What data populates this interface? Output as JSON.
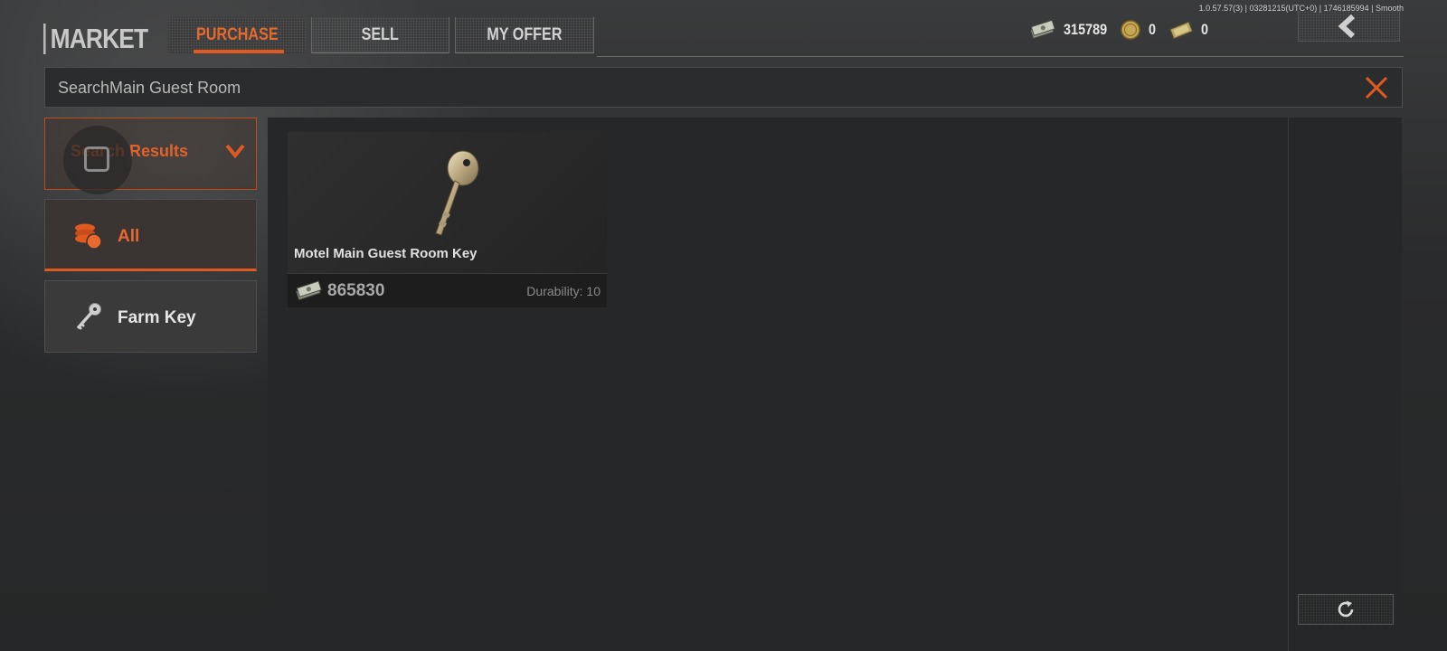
{
  "version_info": "1.0.57.57(3) | 03281215(UTC+0) | 1746185994 | Smooth",
  "header": {
    "title": "MARKET",
    "tabs": [
      {
        "label": "PURCHASE",
        "active": true
      },
      {
        "label": "SELL",
        "active": false
      },
      {
        "label": "MY OFFER",
        "active": false
      }
    ]
  },
  "currencies": [
    {
      "icon": "cash-stack-icon",
      "value": "315789"
    },
    {
      "icon": "gold-coin-icon",
      "value": "0"
    },
    {
      "icon": "gold-bar-icon",
      "value": "0"
    }
  ],
  "search": {
    "value": "SearchMain Guest Room"
  },
  "filters": {
    "dropdown_label": "Search Results",
    "categories": [
      {
        "label": "All",
        "icon": "coins-icon",
        "active": true
      },
      {
        "label": "Farm Key",
        "icon": "key-icon",
        "active": false
      }
    ]
  },
  "items": [
    {
      "name": "Motel Main Guest Room Key",
      "price": "865830",
      "durability": "Durability: 10",
      "icon": "key-icon"
    }
  ],
  "colors": {
    "accent": "#e05a20",
    "background": "#2a2b2c",
    "panel": "#262728"
  }
}
